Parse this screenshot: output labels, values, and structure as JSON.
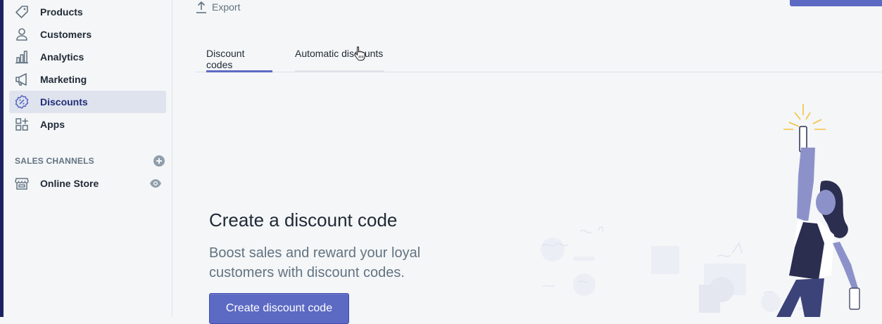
{
  "sidebar": {
    "items": [
      {
        "label": "Products",
        "icon": "tag-icon"
      },
      {
        "label": "Customers",
        "icon": "person-icon"
      },
      {
        "label": "Analytics",
        "icon": "bar-chart-icon"
      },
      {
        "label": "Marketing",
        "icon": "megaphone-icon"
      },
      {
        "label": "Discounts",
        "icon": "discount-icon",
        "active": true
      },
      {
        "label": "Apps",
        "icon": "apps-icon"
      }
    ],
    "sales_channels_label": "SALES CHANNELS",
    "channels": [
      {
        "label": "Online Store",
        "icon": "store-icon"
      }
    ]
  },
  "toolbar": {
    "export_label": "Export"
  },
  "tabs": [
    {
      "label": "Discount codes",
      "active": true
    },
    {
      "label": "Automatic discounts",
      "active": false
    }
  ],
  "empty_state": {
    "title": "Create a discount code",
    "text": "Boost sales and reward your loyal customers with discount codes.",
    "button_label": "Create discount code"
  },
  "colors": {
    "accent": "#5c6ac4",
    "active_nav_bg": "#dfe3ee",
    "sparkle": "#f5c13d"
  }
}
